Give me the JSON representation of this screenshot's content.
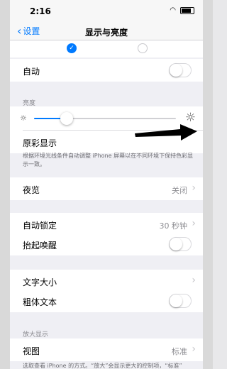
{
  "status": {
    "time": "2:16"
  },
  "nav": {
    "back_label": "设置",
    "title": "显示与亮度"
  },
  "appearance": {
    "selected": "left"
  },
  "auto": {
    "label": "自动",
    "on": false
  },
  "brightness": {
    "section": "亮度",
    "level": 0.23
  },
  "true_tone": {
    "label": "原彩显示",
    "footer": "根据环境光线条件自动调整 iPhone 屏幕以在不同环境下保持色彩显示一致。"
  },
  "night_shift": {
    "label": "夜览",
    "value": "关闭"
  },
  "auto_lock": {
    "label": "自动锁定",
    "value": "30 秒钟"
  },
  "raise_to_wake": {
    "label": "抬起唤醒",
    "on": false
  },
  "text_size": {
    "label": "文字大小"
  },
  "bold_text": {
    "label": "粗体文本",
    "on": false
  },
  "zoom": {
    "section": "放大显示",
    "view_label": "视图",
    "view_value": "标准",
    "footer": "选取查看 iPhone 的方式。“放大”会显示更大的控制项，“标准”"
  },
  "colors": {
    "accent": "#007aff",
    "arrow": "#000000"
  }
}
